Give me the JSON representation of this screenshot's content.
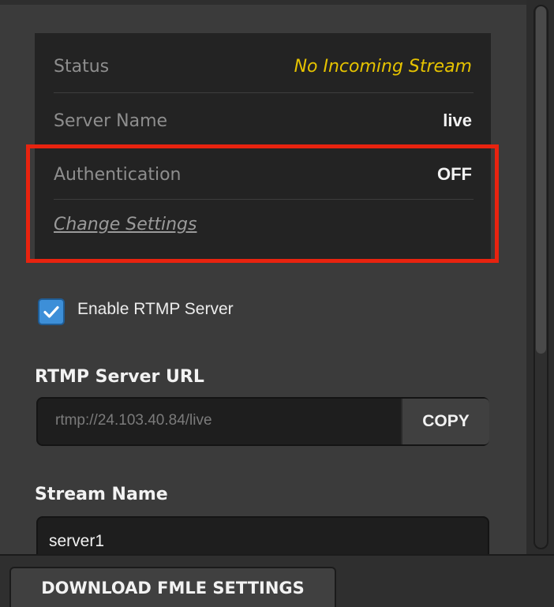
{
  "status_box": {
    "status_label": "Status",
    "status_value": "No Incoming Stream",
    "server_name_label": "Server Name",
    "server_name_value": "live",
    "authentication_label": "Authentication",
    "authentication_value": "OFF",
    "change_settings_link": "Change Settings"
  },
  "rtmp": {
    "enable_label": "Enable RTMP Server",
    "enabled": true,
    "server_url_title": "RTMP Server URL",
    "server_url_value": "rtmp://24.103.40.84/live",
    "copy_label": "COPY",
    "stream_name_title": "Stream Name",
    "stream_name_value": "server1"
  },
  "footer": {
    "download_label": "DOWNLOAD FMLE SETTINGS"
  },
  "colors": {
    "accent_checkbox": "#3d8fd8",
    "status_warning": "#e6c300",
    "highlight_border": "#e8230f"
  },
  "icons": {
    "checkbox": "check-icon"
  }
}
